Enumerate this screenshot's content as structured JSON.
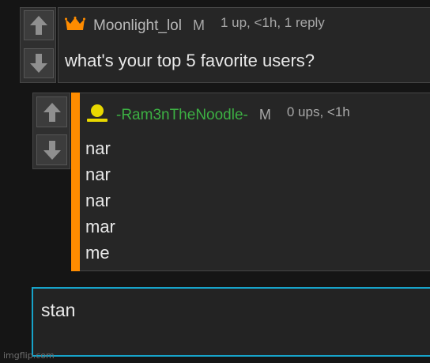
{
  "comment": {
    "username": "Moonlight_lol",
    "gender": "M",
    "meta": "1 up, <1h, 1 reply",
    "text": "what's your top 5 favorite users?",
    "badge_icon": "crown-icon",
    "username_color": "#b8b8b8"
  },
  "reply": {
    "username": "-Ram3nTheNoodle-",
    "gender": "M",
    "meta": "0 ups, <1h",
    "lines": [
      "nar",
      "nar",
      "nar",
      "mar",
      "me"
    ],
    "badge_icon": "user-icon",
    "username_color": "#3cb043",
    "accent_color": "#ff8c00"
  },
  "reply_input": {
    "value": "stan"
  },
  "watermark": "imgflip.com"
}
